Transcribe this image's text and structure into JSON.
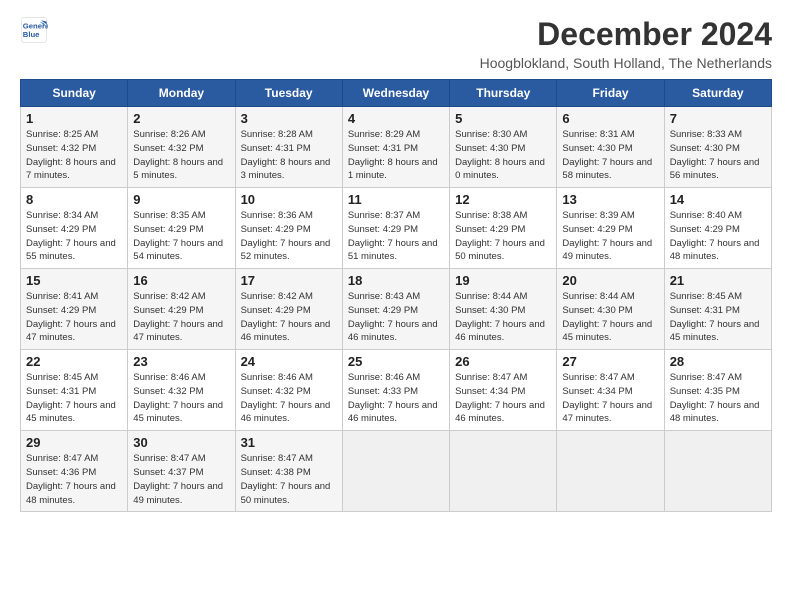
{
  "logo": {
    "line1": "General",
    "line2": "Blue"
  },
  "title": "December 2024",
  "subtitle": "Hoogblokland, South Holland, The Netherlands",
  "days_of_week": [
    "Sunday",
    "Monday",
    "Tuesday",
    "Wednesday",
    "Thursday",
    "Friday",
    "Saturday"
  ],
  "weeks": [
    [
      {
        "day": "1",
        "sunrise": "Sunrise: 8:25 AM",
        "sunset": "Sunset: 4:32 PM",
        "daylight": "Daylight: 8 hours and 7 minutes."
      },
      {
        "day": "2",
        "sunrise": "Sunrise: 8:26 AM",
        "sunset": "Sunset: 4:32 PM",
        "daylight": "Daylight: 8 hours and 5 minutes."
      },
      {
        "day": "3",
        "sunrise": "Sunrise: 8:28 AM",
        "sunset": "Sunset: 4:31 PM",
        "daylight": "Daylight: 8 hours and 3 minutes."
      },
      {
        "day": "4",
        "sunrise": "Sunrise: 8:29 AM",
        "sunset": "Sunset: 4:31 PM",
        "daylight": "Daylight: 8 hours and 1 minute."
      },
      {
        "day": "5",
        "sunrise": "Sunrise: 8:30 AM",
        "sunset": "Sunset: 4:30 PM",
        "daylight": "Daylight: 8 hours and 0 minutes."
      },
      {
        "day": "6",
        "sunrise": "Sunrise: 8:31 AM",
        "sunset": "Sunset: 4:30 PM",
        "daylight": "Daylight: 7 hours and 58 minutes."
      },
      {
        "day": "7",
        "sunrise": "Sunrise: 8:33 AM",
        "sunset": "Sunset: 4:30 PM",
        "daylight": "Daylight: 7 hours and 56 minutes."
      }
    ],
    [
      {
        "day": "8",
        "sunrise": "Sunrise: 8:34 AM",
        "sunset": "Sunset: 4:29 PM",
        "daylight": "Daylight: 7 hours and 55 minutes."
      },
      {
        "day": "9",
        "sunrise": "Sunrise: 8:35 AM",
        "sunset": "Sunset: 4:29 PM",
        "daylight": "Daylight: 7 hours and 54 minutes."
      },
      {
        "day": "10",
        "sunrise": "Sunrise: 8:36 AM",
        "sunset": "Sunset: 4:29 PM",
        "daylight": "Daylight: 7 hours and 52 minutes."
      },
      {
        "day": "11",
        "sunrise": "Sunrise: 8:37 AM",
        "sunset": "Sunset: 4:29 PM",
        "daylight": "Daylight: 7 hours and 51 minutes."
      },
      {
        "day": "12",
        "sunrise": "Sunrise: 8:38 AM",
        "sunset": "Sunset: 4:29 PM",
        "daylight": "Daylight: 7 hours and 50 minutes."
      },
      {
        "day": "13",
        "sunrise": "Sunrise: 8:39 AM",
        "sunset": "Sunset: 4:29 PM",
        "daylight": "Daylight: 7 hours and 49 minutes."
      },
      {
        "day": "14",
        "sunrise": "Sunrise: 8:40 AM",
        "sunset": "Sunset: 4:29 PM",
        "daylight": "Daylight: 7 hours and 48 minutes."
      }
    ],
    [
      {
        "day": "15",
        "sunrise": "Sunrise: 8:41 AM",
        "sunset": "Sunset: 4:29 PM",
        "daylight": "Daylight: 7 hours and 47 minutes."
      },
      {
        "day": "16",
        "sunrise": "Sunrise: 8:42 AM",
        "sunset": "Sunset: 4:29 PM",
        "daylight": "Daylight: 7 hours and 47 minutes."
      },
      {
        "day": "17",
        "sunrise": "Sunrise: 8:42 AM",
        "sunset": "Sunset: 4:29 PM",
        "daylight": "Daylight: 7 hours and 46 minutes."
      },
      {
        "day": "18",
        "sunrise": "Sunrise: 8:43 AM",
        "sunset": "Sunset: 4:29 PM",
        "daylight": "Daylight: 7 hours and 46 minutes."
      },
      {
        "day": "19",
        "sunrise": "Sunrise: 8:44 AM",
        "sunset": "Sunset: 4:30 PM",
        "daylight": "Daylight: 7 hours and 46 minutes."
      },
      {
        "day": "20",
        "sunrise": "Sunrise: 8:44 AM",
        "sunset": "Sunset: 4:30 PM",
        "daylight": "Daylight: 7 hours and 45 minutes."
      },
      {
        "day": "21",
        "sunrise": "Sunrise: 8:45 AM",
        "sunset": "Sunset: 4:31 PM",
        "daylight": "Daylight: 7 hours and 45 minutes."
      }
    ],
    [
      {
        "day": "22",
        "sunrise": "Sunrise: 8:45 AM",
        "sunset": "Sunset: 4:31 PM",
        "daylight": "Daylight: 7 hours and 45 minutes."
      },
      {
        "day": "23",
        "sunrise": "Sunrise: 8:46 AM",
        "sunset": "Sunset: 4:32 PM",
        "daylight": "Daylight: 7 hours and 45 minutes."
      },
      {
        "day": "24",
        "sunrise": "Sunrise: 8:46 AM",
        "sunset": "Sunset: 4:32 PM",
        "daylight": "Daylight: 7 hours and 46 minutes."
      },
      {
        "day": "25",
        "sunrise": "Sunrise: 8:46 AM",
        "sunset": "Sunset: 4:33 PM",
        "daylight": "Daylight: 7 hours and 46 minutes."
      },
      {
        "day": "26",
        "sunrise": "Sunrise: 8:47 AM",
        "sunset": "Sunset: 4:34 PM",
        "daylight": "Daylight: 7 hours and 46 minutes."
      },
      {
        "day": "27",
        "sunrise": "Sunrise: 8:47 AM",
        "sunset": "Sunset: 4:34 PM",
        "daylight": "Daylight: 7 hours and 47 minutes."
      },
      {
        "day": "28",
        "sunrise": "Sunrise: 8:47 AM",
        "sunset": "Sunset: 4:35 PM",
        "daylight": "Daylight: 7 hours and 48 minutes."
      }
    ],
    [
      {
        "day": "29",
        "sunrise": "Sunrise: 8:47 AM",
        "sunset": "Sunset: 4:36 PM",
        "daylight": "Daylight: 7 hours and 48 minutes."
      },
      {
        "day": "30",
        "sunrise": "Sunrise: 8:47 AM",
        "sunset": "Sunset: 4:37 PM",
        "daylight": "Daylight: 7 hours and 49 minutes."
      },
      {
        "day": "31",
        "sunrise": "Sunrise: 8:47 AM",
        "sunset": "Sunset: 4:38 PM",
        "daylight": "Daylight: 7 hours and 50 minutes."
      },
      null,
      null,
      null,
      null
    ]
  ]
}
